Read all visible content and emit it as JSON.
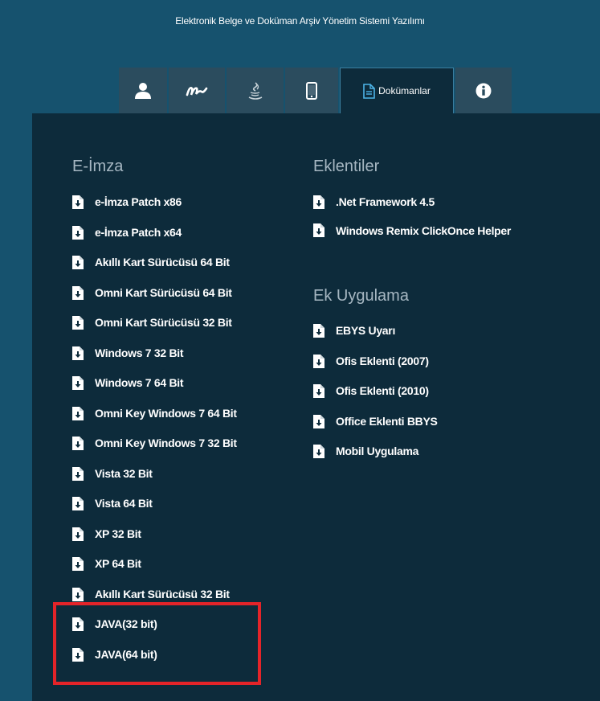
{
  "header": {
    "subtitle": "Elektronik Belge ve Doküman Arşiv Yönetim Sistemi Yazılımı"
  },
  "tabs": [
    {
      "icon": "user-icon"
    },
    {
      "icon": "signature-icon"
    },
    {
      "icon": "java-icon"
    },
    {
      "icon": "mobile-icon"
    },
    {
      "icon": "document-icon",
      "label": "Dokümanlar",
      "active": true
    },
    {
      "icon": "info-icon"
    }
  ],
  "eimza": {
    "heading": "E-İmza",
    "items": [
      "e-İmza Patch x86",
      "e-İmza Patch x64",
      "Akıllı Kart Sürücüsü 64 Bit",
      "Omni Kart Sürücüsü 64 Bit",
      "Omni Kart Sürücüsü 32 Bit",
      "Windows 7 32 Bit",
      "Windows 7 64 Bit",
      "Omni Key Windows 7 64 Bit",
      "Omni Key Windows 7 32 Bit",
      "Vista 32 Bit",
      "Vista 64 Bit",
      "XP 32 Bit",
      "XP 64 Bit",
      "Akıllı Kart Sürücüsü 32 Bit",
      "JAVA(32 bit)",
      "JAVA(64 bit)"
    ]
  },
  "eklentiler": {
    "heading": "Eklentiler",
    "items": [
      ".Net Framework 4.5",
      "Windows Remix ClickOnce Helper"
    ]
  },
  "ekuygulama": {
    "heading": "Ek Uygulama",
    "items": [
      "EBYS Uyarı",
      "Ofis Eklenti (2007)",
      "Ofis Eklenti (2010)",
      "Office Eklenti BBYS",
      "Mobil Uygulama"
    ]
  },
  "colors": {
    "background": "#16526e",
    "panel": "#0d2b3b",
    "tab": "#2b4c5e",
    "highlight": "#e42429"
  }
}
